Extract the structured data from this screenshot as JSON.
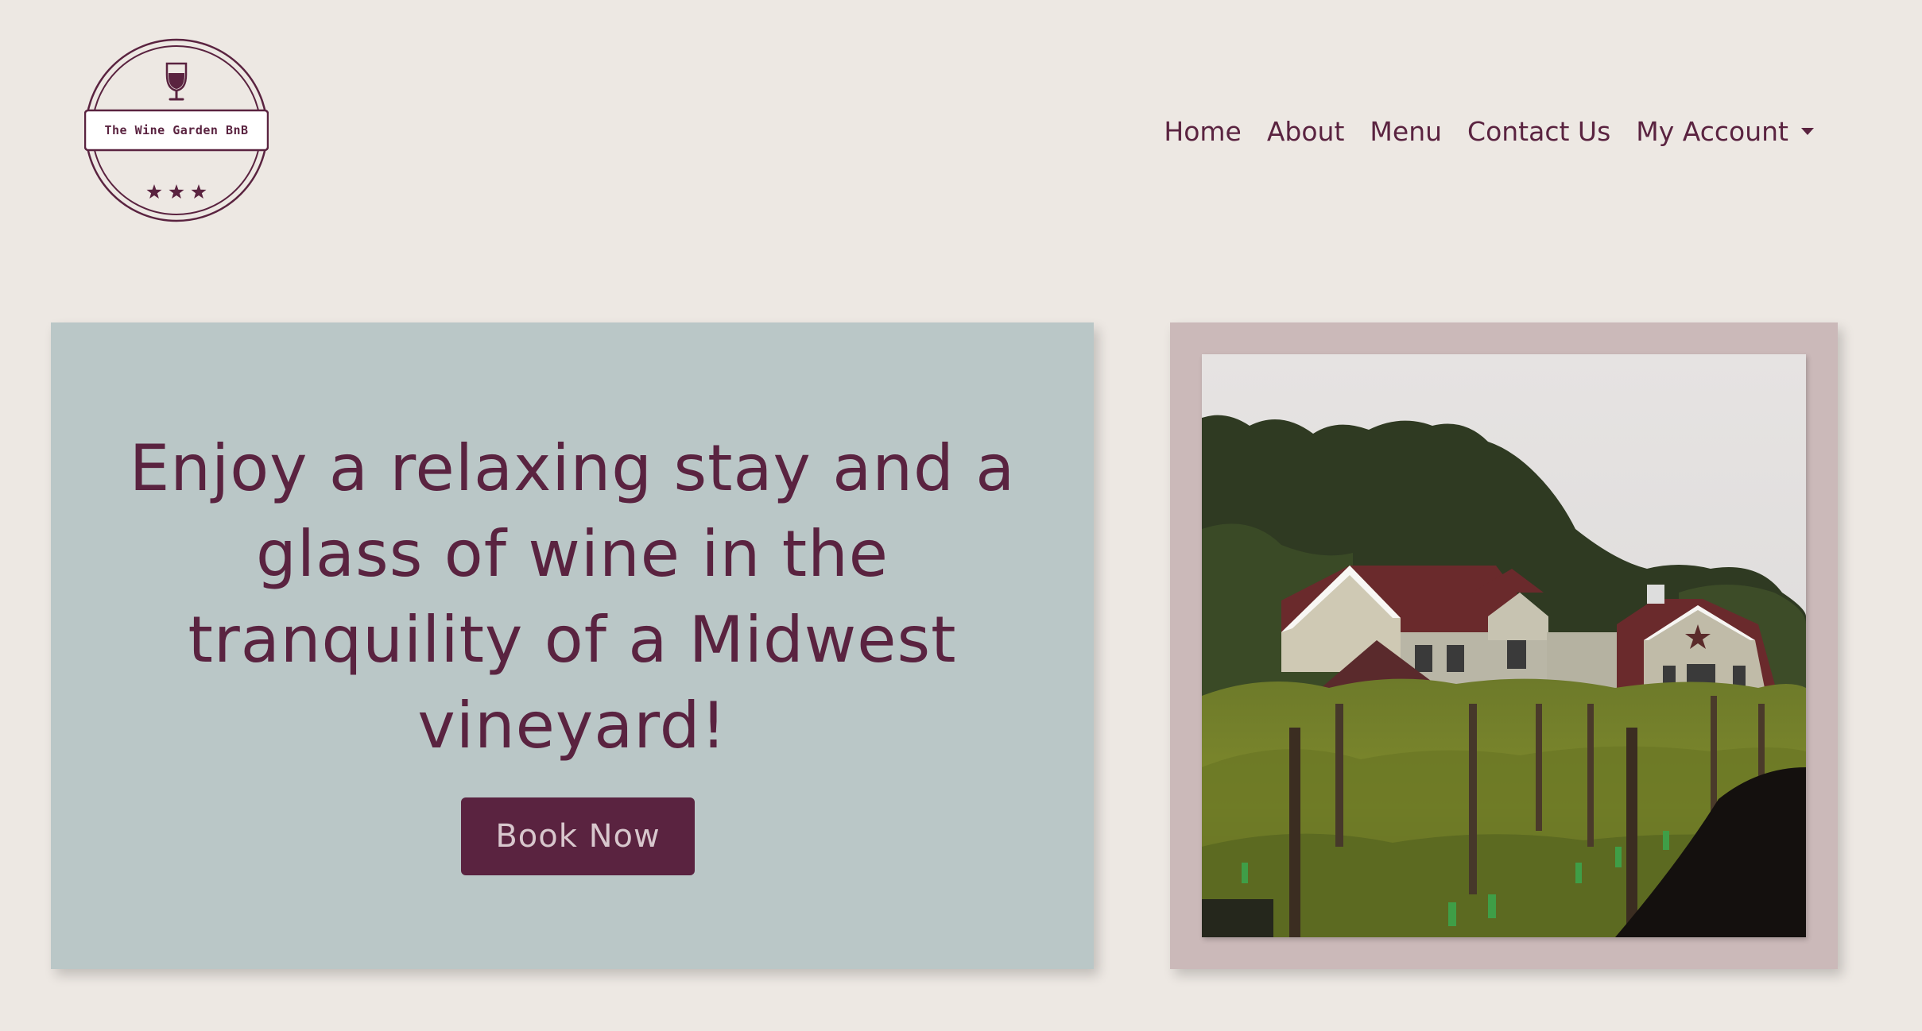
{
  "brand": {
    "name": "The Wine Garden BnB",
    "logo_icon": "wine-glass-icon",
    "logo_stars": "★ ★ ★"
  },
  "nav": {
    "items": [
      {
        "label": "Home"
      },
      {
        "label": "About"
      },
      {
        "label": "Menu"
      },
      {
        "label": "Contact Us"
      },
      {
        "label": "My Account"
      }
    ],
    "account_icon": "caret-down-icon"
  },
  "hero": {
    "headline": "Enjoy a relaxing stay and a glass of wine in the tranquility of a Midwest vineyard!",
    "cta_label": "Book Now"
  },
  "colors": {
    "background": "#ede8e3",
    "brand": "#5a2340",
    "hero_card": "#bac7c7",
    "photo_frame": "#cbb9b9",
    "button_text": "#d8c7cd"
  }
}
